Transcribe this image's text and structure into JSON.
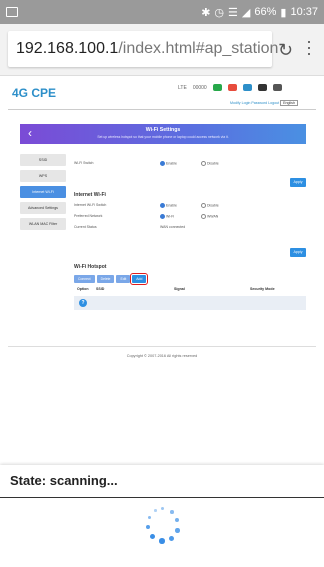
{
  "statusbar": {
    "time": "10:37",
    "battery": "66%"
  },
  "browser": {
    "url_host": "192.168.100.1",
    "url_path": "/index.html#ap_station"
  },
  "router": {
    "logo": "4G CPE",
    "network_type": "LTE",
    "signal_label": "00000",
    "top_links": {
      "modify_password": "Modify Login Password",
      "logout": "Logout",
      "language": "English"
    },
    "banner_title": "Wi-Fi Settings",
    "banner_subtitle": "Set up wireless hotspot so that your mobile phone or laptop could access network via it.",
    "sidebar": [
      {
        "label": "SSID"
      },
      {
        "label": "WPS"
      },
      {
        "label": "Internet Wi-Fi",
        "active": true
      },
      {
        "label": "Advanced Settings"
      },
      {
        "label": "WLAN MAC Filter"
      }
    ],
    "wifi_switch": {
      "label": "Wi-Fi Switch",
      "enable": "Enable",
      "disable": "Disable"
    },
    "apply": "Apply",
    "internet_wifi": {
      "title": "Internet Wi-Fi",
      "switch_label": "Internet Wi-Fi Switch",
      "enable": "Enable",
      "disable": "Disable",
      "preferred_label": "Preferred Network",
      "preferred_wifi": "Wi-Fi",
      "preferred_wwan": "WWAN",
      "status_label": "Current Status",
      "status_value": "WAN connected"
    },
    "hotspot": {
      "title": "Wi-Fi Hotspot",
      "buttons": [
        "Connect",
        "Delete",
        "Edit",
        "Add"
      ],
      "columns": [
        "Option",
        "SSID",
        "Signal",
        "Security Mode"
      ]
    },
    "copyright": "Copyright © 2007-2016 All rights reserved"
  },
  "dialog": {
    "title": "State: scanning..."
  }
}
